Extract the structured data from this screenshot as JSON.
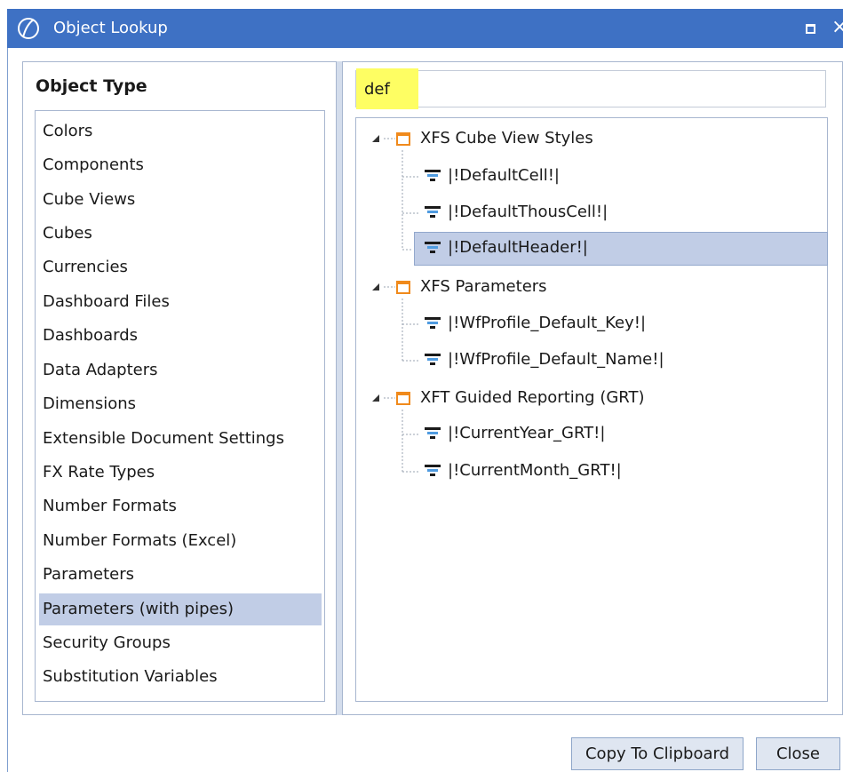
{
  "window": {
    "title": "Object Lookup"
  },
  "left_panel": {
    "heading": "Object Type",
    "items": [
      "Colors",
      "Components",
      "Cube Views",
      "Cubes",
      "Currencies",
      "Dashboard Files",
      "Dashboards",
      "Data Adapters",
      "Dimensions",
      "Extensible Document Settings",
      "FX Rate Types",
      "Number Formats",
      "Number Formats (Excel)",
      "Parameters",
      "Parameters (with pipes)",
      "Security Groups",
      "Substitution Variables"
    ],
    "selected": "Parameters (with pipes)"
  },
  "search": {
    "value": "def",
    "highlight_color": "#fefe63"
  },
  "tree": {
    "groups": [
      {
        "label": "XFS Cube View Styles",
        "children": [
          "|!DefaultCell!|",
          "|!DefaultThousCell!|",
          "|!DefaultHeader!|"
        ]
      },
      {
        "label": "XFS Parameters",
        "children": [
          "|!WfProfile_Default_Key!|",
          "|!WfProfile_Default_Name!|"
        ]
      },
      {
        "label": "XFT Guided Reporting (GRT)",
        "children": [
          "|!CurrentYear_GRT!|",
          "|!CurrentMonth_GRT!|"
        ]
      }
    ],
    "selected": "|!DefaultHeader!|"
  },
  "buttons": {
    "copy": "Copy To Clipboard",
    "close": "Close"
  },
  "colors": {
    "titlebar": "#3e71c4",
    "selection": "#c1cde6",
    "folder": "#f08a1c"
  }
}
